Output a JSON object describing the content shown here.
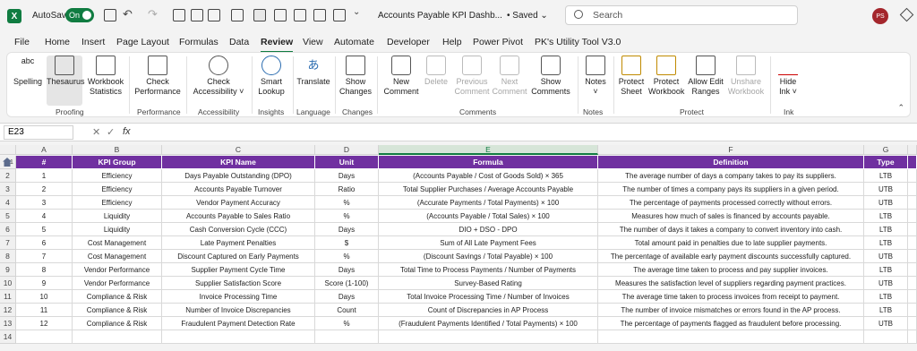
{
  "titlebar": {
    "autosave_label": "AutoSave",
    "toggle_label": "On",
    "doc_title": "Accounts Payable KPI Dashb...",
    "saved": "• Saved ⌄",
    "search_placeholder": "Search",
    "avatar": "PS"
  },
  "menu": [
    "File",
    "Home",
    "Insert",
    "Page Layout",
    "Formulas",
    "Data",
    "Review",
    "View",
    "Automate",
    "Developer",
    "Help",
    "Power Pivot",
    "PK's Utility Tool V3.0"
  ],
  "ribbon": {
    "buttons": [
      {
        "l1": "Spelling",
        "l2": ""
      },
      {
        "l1": "Thesaurus",
        "l2": ""
      },
      {
        "l1": "Workbook",
        "l2": "Statistics"
      },
      {
        "l1": "Check",
        "l2": "Performance"
      },
      {
        "l1": "Check",
        "l2": "Accessibility ˅"
      },
      {
        "l1": "Smart",
        "l2": "Lookup"
      },
      {
        "l1": "Translate",
        "l2": ""
      },
      {
        "l1": "Show",
        "l2": "Changes"
      },
      {
        "l1": "New",
        "l2": "Comment"
      },
      {
        "l1": "Delete",
        "l2": ""
      },
      {
        "l1": "Previous",
        "l2": "Comment"
      },
      {
        "l1": "Next",
        "l2": "Comment"
      },
      {
        "l1": "Show",
        "l2": "Comments"
      },
      {
        "l1": "Notes",
        "l2": "˅"
      },
      {
        "l1": "Protect",
        "l2": "Sheet"
      },
      {
        "l1": "Protect",
        "l2": "Workbook"
      },
      {
        "l1": "Allow Edit",
        "l2": "Ranges"
      },
      {
        "l1": "Unshare",
        "l2": "Workbook"
      },
      {
        "l1": "Hide",
        "l2": "Ink ˅"
      }
    ],
    "groups": [
      "Proofing",
      "Performance",
      "Accessibility",
      "Insights",
      "Language",
      "Changes",
      "Comments",
      "Notes",
      "Protect",
      "Ink"
    ],
    "spelling_top": "abc"
  },
  "formula_bar": {
    "name_box": "E23",
    "fx": "fx",
    "value": ""
  },
  "columns": [
    "A",
    "B",
    "C",
    "D",
    "E",
    "F",
    "G"
  ],
  "row_numbers": [
    "1",
    "2",
    "3",
    "4",
    "5",
    "6",
    "7",
    "8",
    "9",
    "10",
    "11",
    "12",
    "13",
    "14"
  ],
  "table": {
    "headers": [
      "#",
      "KPI Group",
      "KPI Name",
      "Unit",
      "Formula",
      "Definition",
      "Type"
    ],
    "rows": [
      [
        "1",
        "Efficiency",
        "Days Payable Outstanding (DPO)",
        "Days",
        "(Accounts Payable / Cost of Goods Sold) × 365",
        "The average number of days a company takes to pay its suppliers.",
        "LTB"
      ],
      [
        "2",
        "Efficiency",
        "Accounts Payable Turnover",
        "Ratio",
        "Total Supplier Purchases / Average Accounts Payable",
        "The number of times a company pays its suppliers in a given period.",
        "UTB"
      ],
      [
        "3",
        "Efficiency",
        "Vendor Payment Accuracy",
        "%",
        "(Accurate Payments / Total Payments) × 100",
        "The percentage of payments processed correctly without errors.",
        "UTB"
      ],
      [
        "4",
        "Liquidity",
        "Accounts Payable to Sales Ratio",
        "%",
        "(Accounts Payable / Total Sales) × 100",
        "Measures how much of sales is financed by accounts payable.",
        "LTB"
      ],
      [
        "5",
        "Liquidity",
        "Cash Conversion Cycle (CCC)",
        "Days",
        "DIO + DSO - DPO",
        "The number of days it takes a company to convert inventory into cash.",
        "LTB"
      ],
      [
        "6",
        "Cost Management",
        "Late Payment Penalties",
        "$",
        "Sum of All Late Payment Fees",
        "Total amount paid in penalties due to late supplier payments.",
        "LTB"
      ],
      [
        "7",
        "Cost Management",
        "Discount Captured on Early Payments",
        "%",
        "(Discount Savings / Total Payable) × 100",
        "The percentage of available early payment discounts successfully captured.",
        "UTB"
      ],
      [
        "8",
        "Vendor Performance",
        "Supplier Payment Cycle Time",
        "Days",
        "Total Time to Process Payments / Number of Payments",
        "The average time taken to process and pay supplier invoices.",
        "LTB"
      ],
      [
        "9",
        "Vendor Performance",
        "Supplier Satisfaction Score",
        "Score (1-100)",
        "Survey-Based Rating",
        "Measures the satisfaction level of suppliers regarding payment practices.",
        "UTB"
      ],
      [
        "10",
        "Compliance & Risk",
        "Invoice Processing Time",
        "Days",
        "Total Invoice Processing Time / Number of Invoices",
        "The average time taken to process invoices from receipt to payment.",
        "LTB"
      ],
      [
        "11",
        "Compliance & Risk",
        "Number of Invoice Discrepancies",
        "Count",
        "Count of Discrepancies in AP Process",
        "The number of invoice mismatches or errors found in the AP process.",
        "LTB"
      ],
      [
        "12",
        "Compliance & Risk",
        "Fraudulent Payment Detection Rate",
        "%",
        "(Fraudulent Payments Identified / Total Payments) × 100",
        "The percentage of payments flagged as fraudulent before processing.",
        "UTB"
      ]
    ]
  },
  "colors": {
    "header_bg": "#7030a0",
    "accent": "#107c41"
  }
}
